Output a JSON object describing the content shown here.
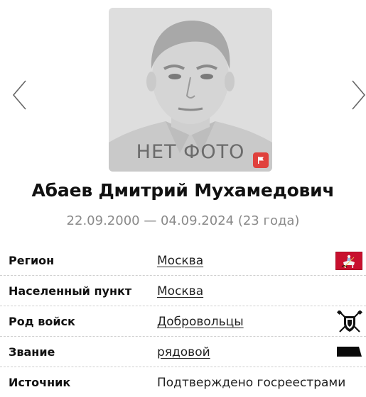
{
  "photo": {
    "placeholder_text": "НЕТ ФОТО",
    "flag_icon": "flag-icon"
  },
  "navigation": {
    "prev_icon": "chevron-left-icon",
    "next_icon": "chevron-right-icon"
  },
  "person": {
    "full_name": "Абаев Дмитрий Мухамедович",
    "dates": "22.09.2000 — 04.09.2024 (23 года)"
  },
  "details": [
    {
      "label": "Регион",
      "value": "Москва",
      "icon": "moscow-coat-of-arms-icon"
    },
    {
      "label": "Населенный пункт",
      "value": "Москва",
      "icon": ""
    },
    {
      "label": "Род войск",
      "value": "Добровольцы",
      "icon": "volunteers-emblem-icon"
    },
    {
      "label": "Звание",
      "value": "рядовой",
      "icon": "rank-insignia-icon"
    },
    {
      "label": "Источник",
      "value": "Подтверждено госреестрами",
      "icon": ""
    }
  ],
  "colors": {
    "flag_button": "#e0413d",
    "moscow_flag": "#c8102e",
    "dates_text": "#8a8a8a"
  }
}
